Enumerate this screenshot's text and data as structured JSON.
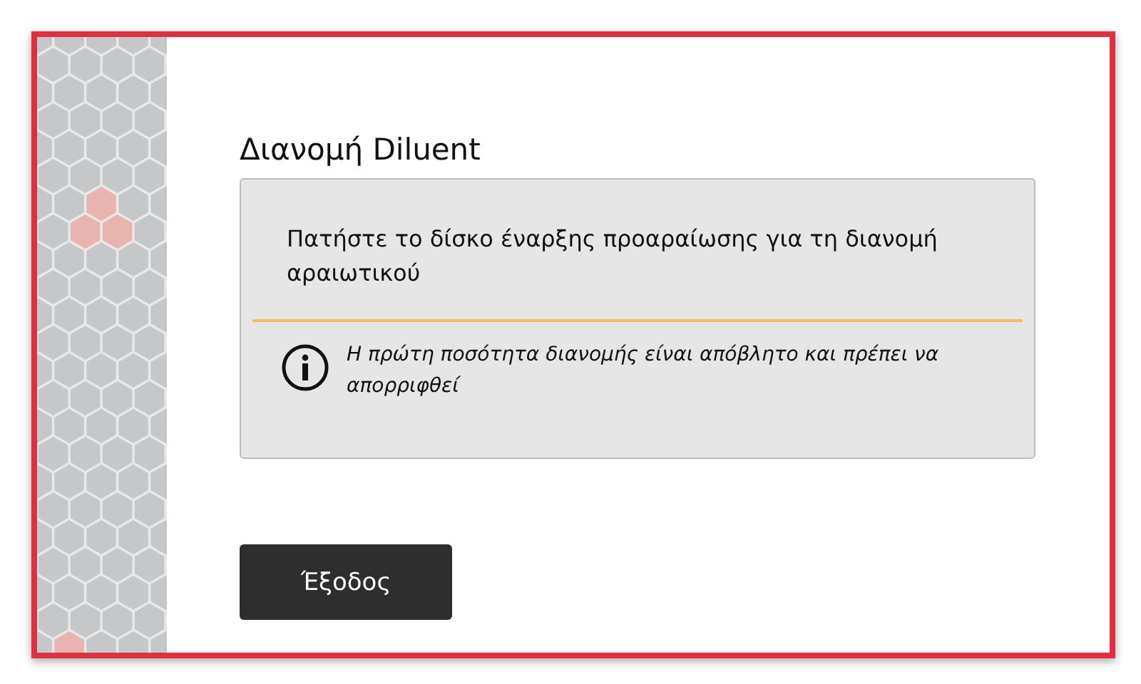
{
  "dialog": {
    "title": "Διανομή Diluent",
    "message": "Πατήστε το δίσκο έναρξης προαραίωσης για τη διανομή αραιωτικού",
    "note": "Η πρώτη ποσότητα διανομής είναι απόβλητο και πρέπει να απορριφθεί",
    "buttons": [
      {
        "label": "Έξοδος"
      }
    ]
  }
}
